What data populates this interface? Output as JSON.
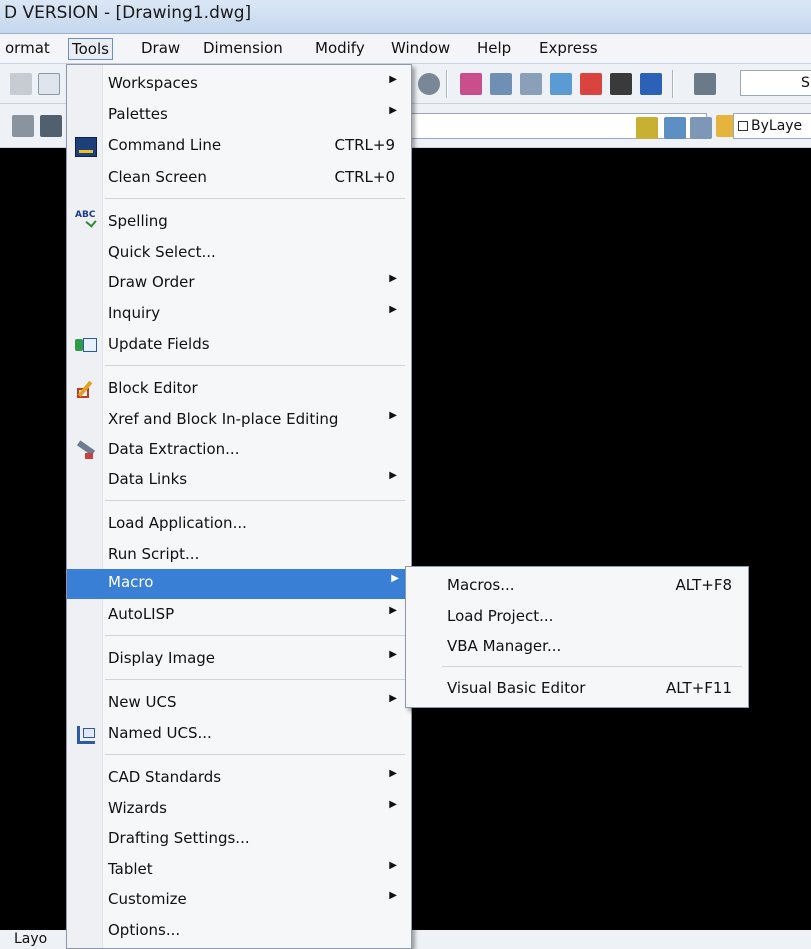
{
  "app": {
    "title": "D VERSION - [Drawing1.dwg]"
  },
  "menubar": [
    {
      "label": "ormat"
    },
    {
      "label": "Tools"
    },
    {
      "label": "Draw"
    },
    {
      "label": "Dimension"
    },
    {
      "label": "Modify"
    },
    {
      "label": "Window"
    },
    {
      "label": "Help"
    },
    {
      "label": "Express"
    }
  ],
  "toolbar": {
    "bylayer_label": "ByLaye",
    "truncated_text": "S"
  },
  "tools_menu": {
    "items": [
      {
        "label": "Workspaces",
        "submenu": true
      },
      {
        "label": "Palettes",
        "submenu": true
      },
      {
        "label": "Command Line",
        "shortcut": "CTRL+9",
        "icon": "command-line-icon"
      },
      {
        "label": "Clean Screen",
        "shortcut": "CTRL+0"
      },
      {
        "label": "Spelling",
        "icon": "spelling-icon"
      },
      {
        "label": "Quick Select..."
      },
      {
        "label": "Draw Order",
        "submenu": true
      },
      {
        "label": "Inquiry",
        "submenu": true
      },
      {
        "label": "Update Fields",
        "icon": "update-fields-icon"
      },
      {
        "label": "Block Editor",
        "icon": "block-editor-icon"
      },
      {
        "label": "Xref and Block In-place Editing",
        "submenu": true
      },
      {
        "label": "Data Extraction...",
        "icon": "data-extraction-icon"
      },
      {
        "label": "Data Links",
        "submenu": true
      },
      {
        "label": "Load Application..."
      },
      {
        "label": "Run Script..."
      },
      {
        "label": "Macro",
        "submenu": true,
        "selected": true
      },
      {
        "label": "AutoLISP",
        "submenu": true
      },
      {
        "label": "Display Image",
        "submenu": true
      },
      {
        "label": "New UCS",
        "submenu": true
      },
      {
        "label": "Named UCS...",
        "icon": "named-ucs-icon"
      },
      {
        "label": "CAD Standards",
        "submenu": true
      },
      {
        "label": "Wizards",
        "submenu": true
      },
      {
        "label": "Drafting Settings..."
      },
      {
        "label": "Tablet",
        "submenu": true
      },
      {
        "label": "Customize",
        "submenu": true
      },
      {
        "label": "Options..."
      }
    ]
  },
  "macro_submenu": {
    "items": [
      {
        "label": "Macros...",
        "shortcut": "ALT+F8"
      },
      {
        "label": "Load Project..."
      },
      {
        "label": "VBA Manager..."
      },
      {
        "label": "Visual Basic Editor",
        "shortcut": "ALT+F11"
      }
    ]
  },
  "bottom": {
    "tab_label": "Layo"
  },
  "colors": {
    "selection": "#3a7fd6",
    "canvas": "#000000",
    "menu_bg": "#f6f7f9"
  }
}
